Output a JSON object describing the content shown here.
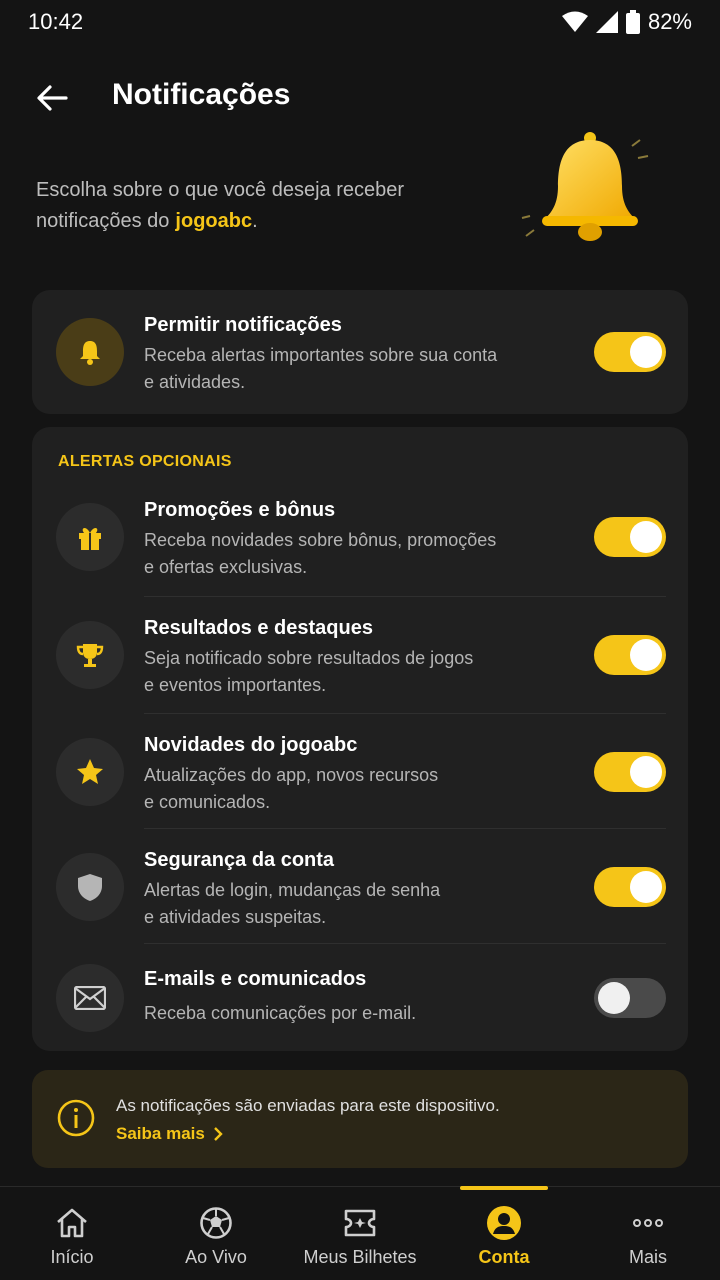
{
  "status_bar": {
    "time": "10:42",
    "battery": "82%"
  },
  "header": {
    "title": "Notificações"
  },
  "intro": {
    "text": "Escolha sobre o que você deseja receber notificações do",
    "brand": "jogoabc",
    "suffix": "."
  },
  "main_card": {
    "title": "Permitir notificações",
    "desc1": "Receba alertas importantes sobre sua conta",
    "desc2": "e atividades.",
    "enabled": true
  },
  "optional": {
    "section_label": "ALERTAS OPCIONAIS",
    "items": [
      {
        "icon": "gift-icon",
        "title": "Promoções e bônus",
        "desc1": "Receba novidades sobre bônus, promoções",
        "desc2": "e ofertas exclusivas.",
        "enabled": true
      },
      {
        "icon": "trophy-icon",
        "title": "Resultados e destaques",
        "desc1": "Seja notificado sobre resultados de jogos",
        "desc2": "e eventos importantes.",
        "enabled": true
      },
      {
        "icon": "star-icon",
        "title": "Novidades do jogoabc",
        "desc1": "Atualizações do app, novos recursos",
        "desc2": "e comunicados.",
        "enabled": true
      },
      {
        "icon": "shield-icon",
        "title": "Segurança da conta",
        "desc1": "Alertas de login, mudanças de senha",
        "desc2": "e atividades suspeitas.",
        "enabled": true
      },
      {
        "icon": "mail-icon",
        "title": "E-mails e comunicados",
        "desc1": "Receba comunicações por e-mail.",
        "desc2": "",
        "enabled": false
      }
    ]
  },
  "info": {
    "text": "As notificações são enviadas para este dispositivo.",
    "link": "Saiba mais"
  },
  "nav": {
    "items": [
      {
        "label": "Início",
        "icon": "home-icon"
      },
      {
        "label": "Ao Vivo",
        "icon": "soccer-ball-icon"
      },
      {
        "label": "Meus Bilhetes",
        "icon": "ticket-icon"
      },
      {
        "label": "Conta",
        "icon": "user-icon"
      },
      {
        "label": "Mais",
        "icon": "more-icon"
      }
    ],
    "active": "Conta"
  },
  "colors": {
    "accent": "#f5c518",
    "background": "#141414",
    "card": "#202020"
  }
}
